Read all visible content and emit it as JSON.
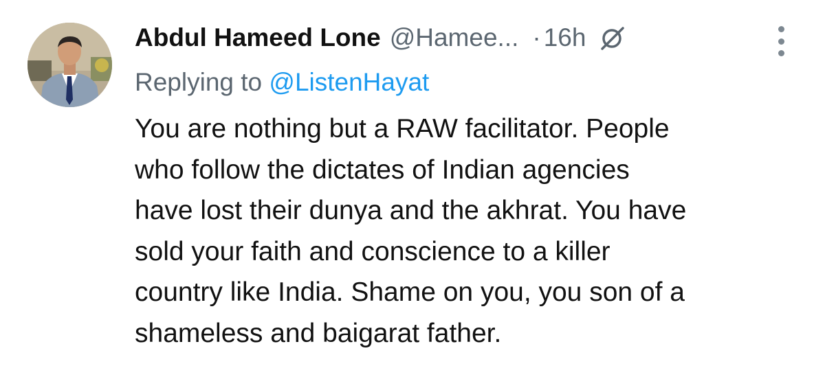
{
  "tweet": {
    "author_name": "Abdul Hameed Lone",
    "author_handle": "@Hamee...",
    "separator": "·",
    "timestamp": "16h",
    "replying_prefix": "Replying to",
    "replying_handle": "@ListenHayat",
    "body_lines": [
      "You are nothing but a RAW facilitator. People",
      "who follow the dictates of Indian agencies",
      "have lost their dunya and the akhrat. You have",
      "sold your faith and conscience to a killer",
      "country like India. Shame on you, you son of a",
      "shameless and baigarat father."
    ]
  },
  "icons": {
    "avatar": "avatar-photo",
    "edited": "edit-indicator-icon",
    "more": "more-options-icon"
  },
  "colors": {
    "text": "#111111",
    "secondary_text": "#5b6670",
    "link": "#1d9bf0",
    "background": "#ffffff"
  }
}
